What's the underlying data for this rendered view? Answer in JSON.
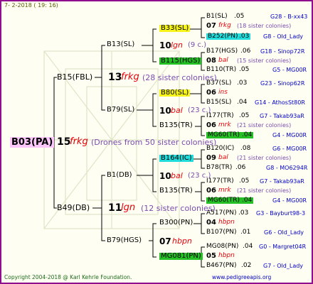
{
  "header": {
    "date": "7- 2-2018 ( 19: 16)"
  },
  "root": {
    "id": "B03(PA)",
    "number": "15",
    "subspecies": "frkg",
    "note": "(Drones from 50 sister colonies)"
  },
  "level1": [
    {
      "id": "B15(FBL)",
      "number": "13",
      "subspecies": "frkg",
      "note": "(28 sister colonies)"
    },
    {
      "id": "B49(DB)",
      "number": "11",
      "subspecies": "lgn",
      "note": "(12 sister colonies)"
    }
  ],
  "level2": [
    {
      "id": "B13(SL)",
      "number": "10",
      "subspecies": "lgn",
      "note": "(9 c.)"
    },
    {
      "id": "B79(SL)",
      "number": "10",
      "subspecies": "bal",
      "note": "(23 c.)"
    },
    {
      "id": "B1(DB)",
      "number": "10",
      "subspecies": "bal",
      "note": "(23 c.)"
    },
    {
      "id": "B79(HGS)",
      "number": "07",
      "subspecies": "hbpn",
      "note": ""
    }
  ],
  "level3": [
    "B33(SL)",
    "B115(HGS)",
    "B80(SL)",
    "B135(TR)",
    "B164(IC)",
    "B135(TR)",
    "B300(PN)",
    "MG081(PN)"
  ],
  "level4": [
    {
      "sire": {
        "id": "B1(SL)",
        "year": ".05",
        "ref": "G28 - B-xx43"
      },
      "num": "07",
      "sub": "frkg",
      "note": "(18 sister colonies)",
      "dam": {
        "id": "B252(PN)",
        "year": ".03",
        "ref": "G8 - Old_Lady"
      }
    },
    {
      "sire": {
        "id": "B17(HGS)",
        "year": ".06",
        "ref": "G18 - Sinop72R"
      },
      "num": "08",
      "sub": "bal",
      "note": "(15 sister colonies)",
      "dam": {
        "id": "B110(TR)",
        "year": ".05",
        "ref": "G5 - MG00R"
      }
    },
    {
      "sire": {
        "id": "B37(SL)",
        "year": ".03",
        "ref": "G23 - Sinop62R"
      },
      "num": "06",
      "sub": "ins",
      "note": "",
      "dam": {
        "id": "B15(SL)",
        "year": ".04",
        "ref": "G14 - AthosSt80R"
      }
    },
    {
      "sire": {
        "id": "I177(TR)",
        "year": ".05",
        "ref": "G7 - Takab93aR"
      },
      "num": "06",
      "sub": "mrk",
      "note": "(21 sister colonies)",
      "dam": {
        "id": "MG60(TR)",
        "year": ".04",
        "ref": "G4 - MG00R"
      }
    },
    {
      "sire": {
        "id": "B120(IC)",
        "year": ".08",
        "ref": "G6 - MG00R"
      },
      "num": "09",
      "sub": "bal",
      "note": "(21 sister colonies)",
      "dam": {
        "id": "B78(TR)",
        "year": ".06",
        "ref": "G8 - MO6294R"
      }
    },
    {
      "sire": {
        "id": "I177(TR)",
        "year": ".05",
        "ref": "G7 - Takab93aR"
      },
      "num": "06",
      "sub": "mrk",
      "note": "(21 sister colonies)",
      "dam": {
        "id": "MG60(TR)",
        "year": ".04",
        "ref": "G4 - MG00R"
      }
    },
    {
      "sire": {
        "id": "A517(PN)",
        "year": ".03",
        "ref": "G3 - Bayburt98-3"
      },
      "num": "04",
      "sub": "hbpn",
      "note": "",
      "dam": {
        "id": "B107(PN)",
        "year": ".01",
        "ref": "G6 - Old_Lady"
      }
    },
    {
      "sire": {
        "id": "MG08(PN)",
        "year": ".04",
        "ref": "G0 - Margret04R"
      },
      "num": "05",
      "sub": "hbpn",
      "note": "",
      "dam": {
        "id": "B467(PN)",
        "year": ".02",
        "ref": "G7 - Old_Lady"
      }
    }
  ],
  "footer": {
    "copyright": "Copyright 2004-2018 @ Karl Kehrle Foundation.",
    "website": "www.pedigreeapis.org"
  },
  "colors": {
    "frame": "#8e0e8e",
    "lines": "#000000",
    "yellow": "#f6f41c",
    "green": "#25c025",
    "cyan": "#22dcdc",
    "pink": "#fbc7fb",
    "red": "#e8000a",
    "purple": "#7a4cb0",
    "blue": "#0000c8"
  }
}
